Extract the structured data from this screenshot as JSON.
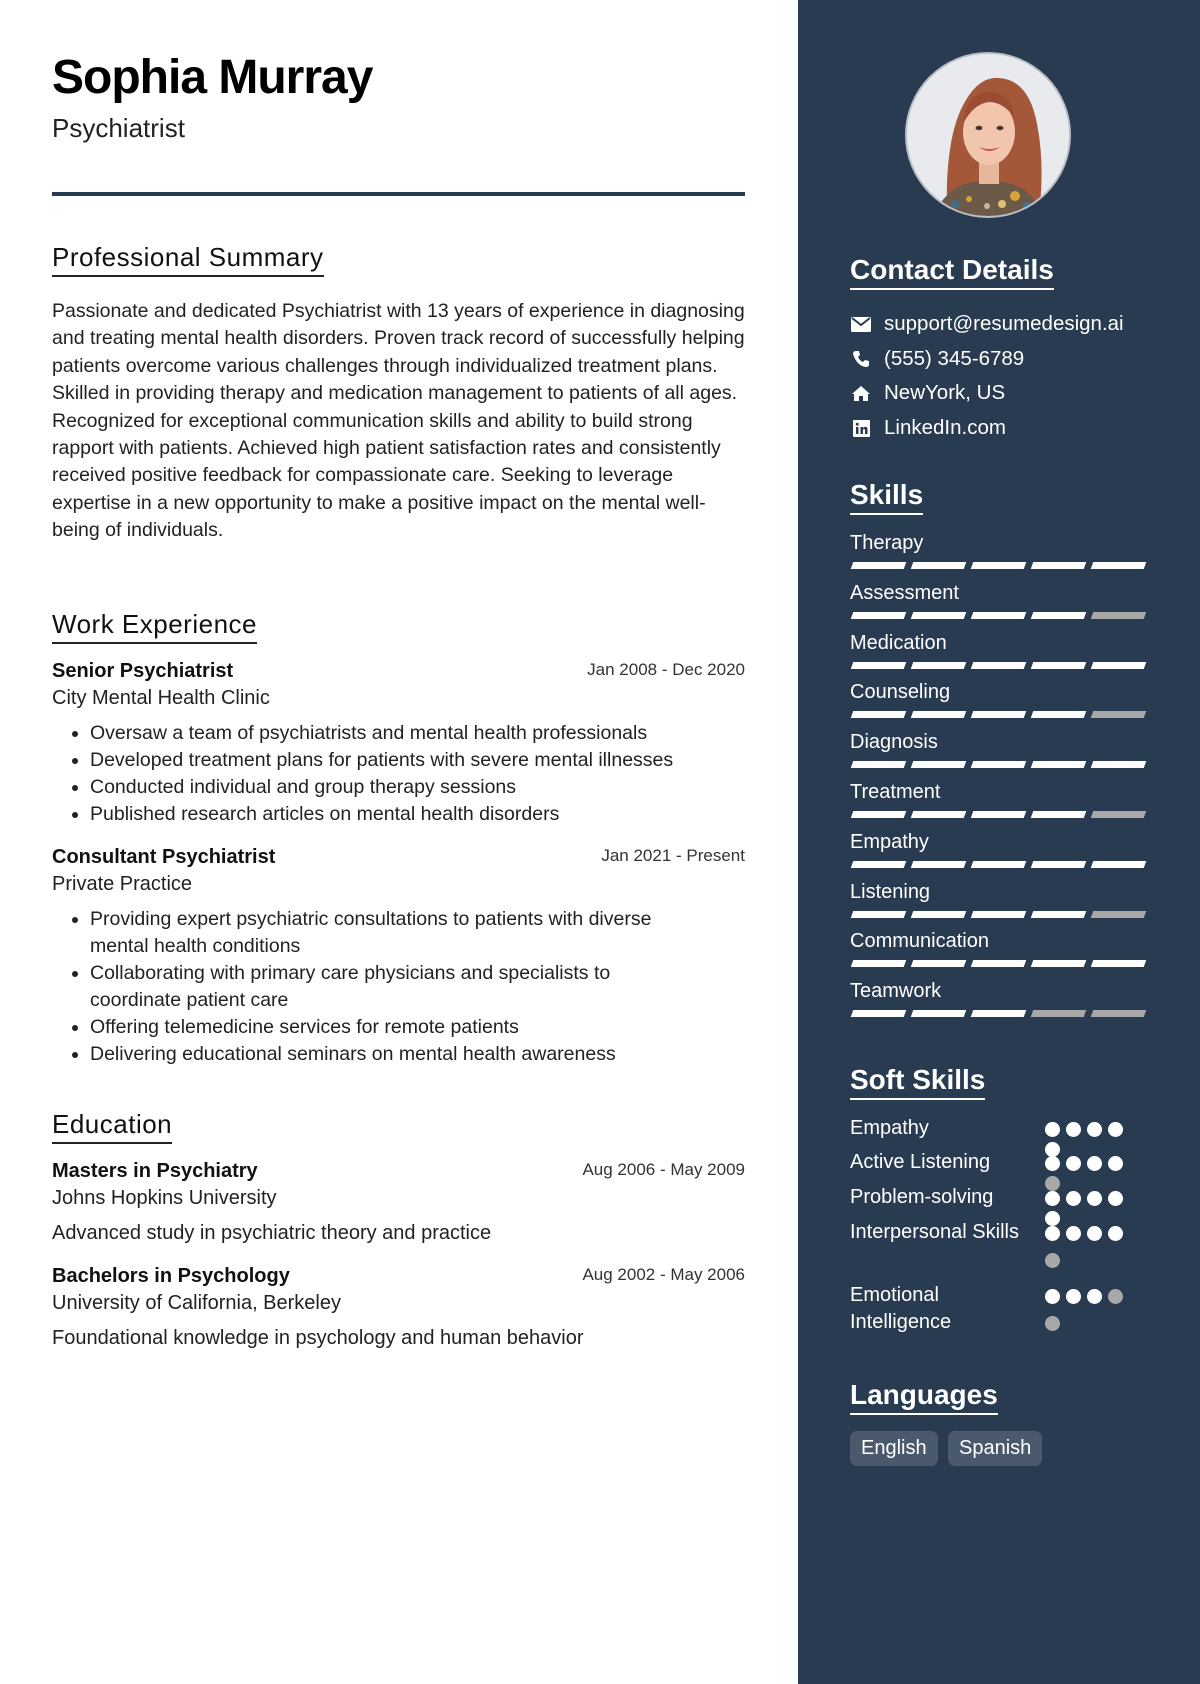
{
  "header": {
    "name": "Sophia Murray",
    "title": "Psychiatrist"
  },
  "summary": {
    "heading": "Professional Summary",
    "text": "Passionate and dedicated Psychiatrist with 13 years of experience in diagnosing and treating mental health disorders. Proven track record of successfully helping patients overcome various challenges through individualized treatment plans. Skilled in providing therapy and medication management to patients of all ages. Recognized for exceptional communication skills and ability to build strong rapport with patients. Achieved high patient satisfaction rates and consistently received positive feedback for compassionate care. Seeking to leverage expertise in a new opportunity to make a positive impact on the mental well-being of individuals."
  },
  "experience": {
    "heading": "Work Experience",
    "jobs": [
      {
        "title": "Senior Psychiatrist",
        "dates": "Jan 2008 - Dec 2020",
        "org": "City Mental Health Clinic",
        "bullets": [
          "Oversaw a team of psychiatrists and mental health professionals",
          "Developed treatment plans for patients with severe mental illnesses",
          "Conducted individual and group therapy sessions",
          "Published research articles on mental health disorders"
        ]
      },
      {
        "title": "Consultant Psychiatrist",
        "dates": "Jan 2021 - Present",
        "org": "Private Practice",
        "bullets": [
          "Providing expert psychiatric consultations to patients with diverse mental health conditions",
          "Collaborating with primary care physicians and specialists to coordinate patient care",
          "Offering telemedicine services for remote patients",
          "Delivering educational seminars on mental health awareness"
        ]
      }
    ]
  },
  "education": {
    "heading": "Education",
    "items": [
      {
        "degree": "Masters in Psychiatry",
        "dates": "Aug 2006 - May 2009",
        "school": "Johns Hopkins University",
        "desc": "Advanced study in psychiatric theory and practice"
      },
      {
        "degree": "Bachelors in Psychology",
        "dates": "Aug 2002 - May 2006",
        "school": "University of California, Berkeley",
        "desc": "Foundational knowledge in psychology and human behavior"
      }
    ]
  },
  "sidebar": {
    "photo_alt": "Profile photo of Sophia Murray",
    "contact": {
      "heading": "Contact Details",
      "items": [
        {
          "icon": "envelope-icon",
          "text": "support@resumedesign.ai"
        },
        {
          "icon": "phone-icon",
          "text": "(555) 345-6789"
        },
        {
          "icon": "home-icon",
          "text": "NewYork, US"
        },
        {
          "icon": "linkedin-icon",
          "text": "LinkedIn.com"
        }
      ]
    },
    "skills": {
      "heading": "Skills",
      "max": 5,
      "items": [
        {
          "label": "Therapy",
          "level": 5
        },
        {
          "label": "Assessment",
          "level": 4
        },
        {
          "label": "Medication",
          "level": 5
        },
        {
          "label": "Counseling",
          "level": 4
        },
        {
          "label": "Diagnosis",
          "level": 5
        },
        {
          "label": "Treatment",
          "level": 4
        },
        {
          "label": "Empathy",
          "level": 5
        },
        {
          "label": "Listening",
          "level": 4
        },
        {
          "label": "Communication",
          "level": 5
        },
        {
          "label": "Teamwork",
          "level": 3
        }
      ]
    },
    "soft_skills": {
      "heading": "Soft Skills",
      "max": 5,
      "items": [
        {
          "label": "Empathy",
          "level": 5
        },
        {
          "label": "Active Listening",
          "level": 4
        },
        {
          "label": "Problem-solving",
          "level": 5
        },
        {
          "label": "Interpersonal Skills",
          "level": 4
        },
        {
          "label": "Emotional Intelligence",
          "level": 3
        }
      ]
    },
    "languages": {
      "heading": "Languages",
      "items": [
        "English",
        "Spanish"
      ]
    }
  },
  "colors": {
    "sidebar_bg": "#283b50",
    "accent_rule": "#283b50",
    "level_on": "#ffffff",
    "level_off": "#a8a8a8",
    "pill_bg": "#4a5a6c"
  }
}
